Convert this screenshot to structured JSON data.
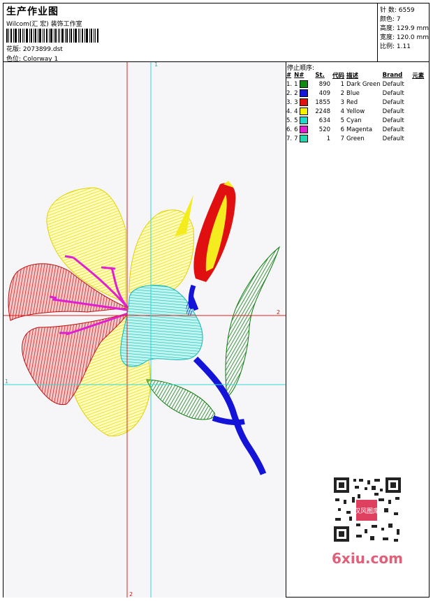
{
  "header": {
    "title": "生产作业图",
    "subtitle": "Wilcom(汇 宏) 装饰工作室",
    "design_label": "花版:",
    "design_value": "2073899.dst",
    "colorway_label": "色位:",
    "colorway_value": "Colorway 1"
  },
  "stats": {
    "stitches": "针 数: 6559",
    "colors": "颜色: 7",
    "height": "高度: 129.9 mm",
    "width": "宽度: 120.0 mm",
    "ratio": "比例: 1.11"
  },
  "stop_sequence": {
    "title": "停止顺序:",
    "headers": [
      "#",
      "N#",
      "St.",
      "代码",
      "描述",
      "Brand",
      "元素"
    ],
    "rows": [
      {
        "idx": "1.",
        "n": "1",
        "color": "#108a10",
        "st": "890",
        "code": "1",
        "desc": "Dark Green",
        "brand": "Default"
      },
      {
        "idx": "2.",
        "n": "2",
        "color": "#1414d8",
        "st": "409",
        "code": "2",
        "desc": "Blue",
        "brand": "Default"
      },
      {
        "idx": "3.",
        "n": "3",
        "color": "#e01010",
        "st": "1855",
        "code": "3",
        "desc": "Red",
        "brand": "Default"
      },
      {
        "idx": "4.",
        "n": "4",
        "color": "#f5f000",
        "st": "2248",
        "code": "4",
        "desc": "Yellow",
        "brand": "Default"
      },
      {
        "idx": "5.",
        "n": "5",
        "color": "#20d8c8",
        "st": "634",
        "code": "5",
        "desc": "Cyan",
        "brand": "Default"
      },
      {
        "idx": "6.",
        "n": "6",
        "color": "#e020d0",
        "st": "520",
        "code": "6",
        "desc": "Magenta",
        "brand": "Default"
      },
      {
        "idx": "7.",
        "n": "7",
        "color": "#20d8b0",
        "st": "1",
        "code": "7",
        "desc": "Green",
        "brand": "Default"
      }
    ]
  },
  "canvas": {
    "axis_labels": {
      "cyan_top": "1",
      "red_right": "2",
      "cyan_left": "1",
      "red_bottom": "2"
    }
  },
  "watermark": {
    "text": "6xiu.com",
    "seal": "汉风图库"
  }
}
